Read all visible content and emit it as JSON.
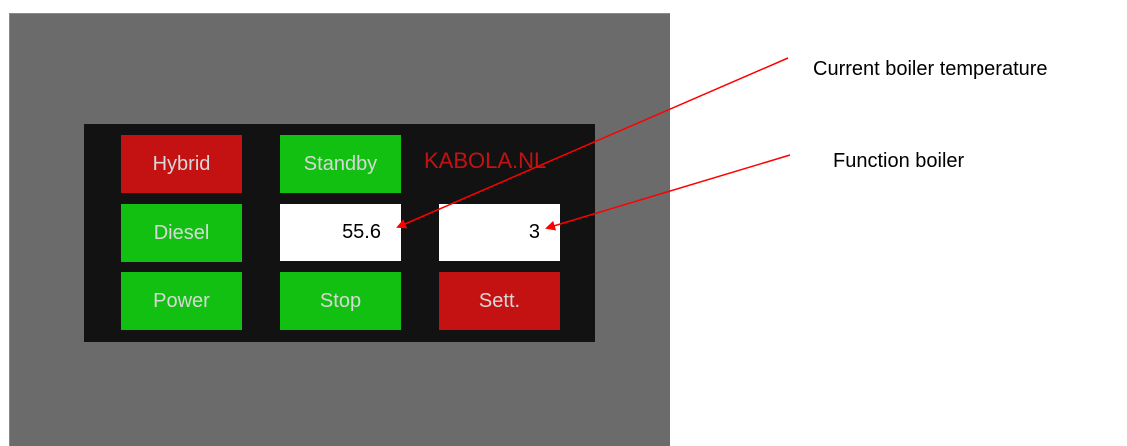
{
  "panel": {
    "brand": "KABOLA.NL",
    "buttons": {
      "hybrid": "Hybrid",
      "standby": "Standby",
      "diesel": "Diesel",
      "power": "Power",
      "stop": "Stop",
      "settings": "Sett."
    },
    "readouts": {
      "boiler_temperature": "55.6",
      "boiler_function": "3"
    }
  },
  "annotations": {
    "temperature_label": "Current boiler temperature",
    "function_label": "Function boiler"
  },
  "colors": {
    "green": "#12c012",
    "red": "#c41212",
    "panel_bg": "#121212",
    "screen_bg": "#6b6b6b",
    "arrow": "#ff0000"
  }
}
